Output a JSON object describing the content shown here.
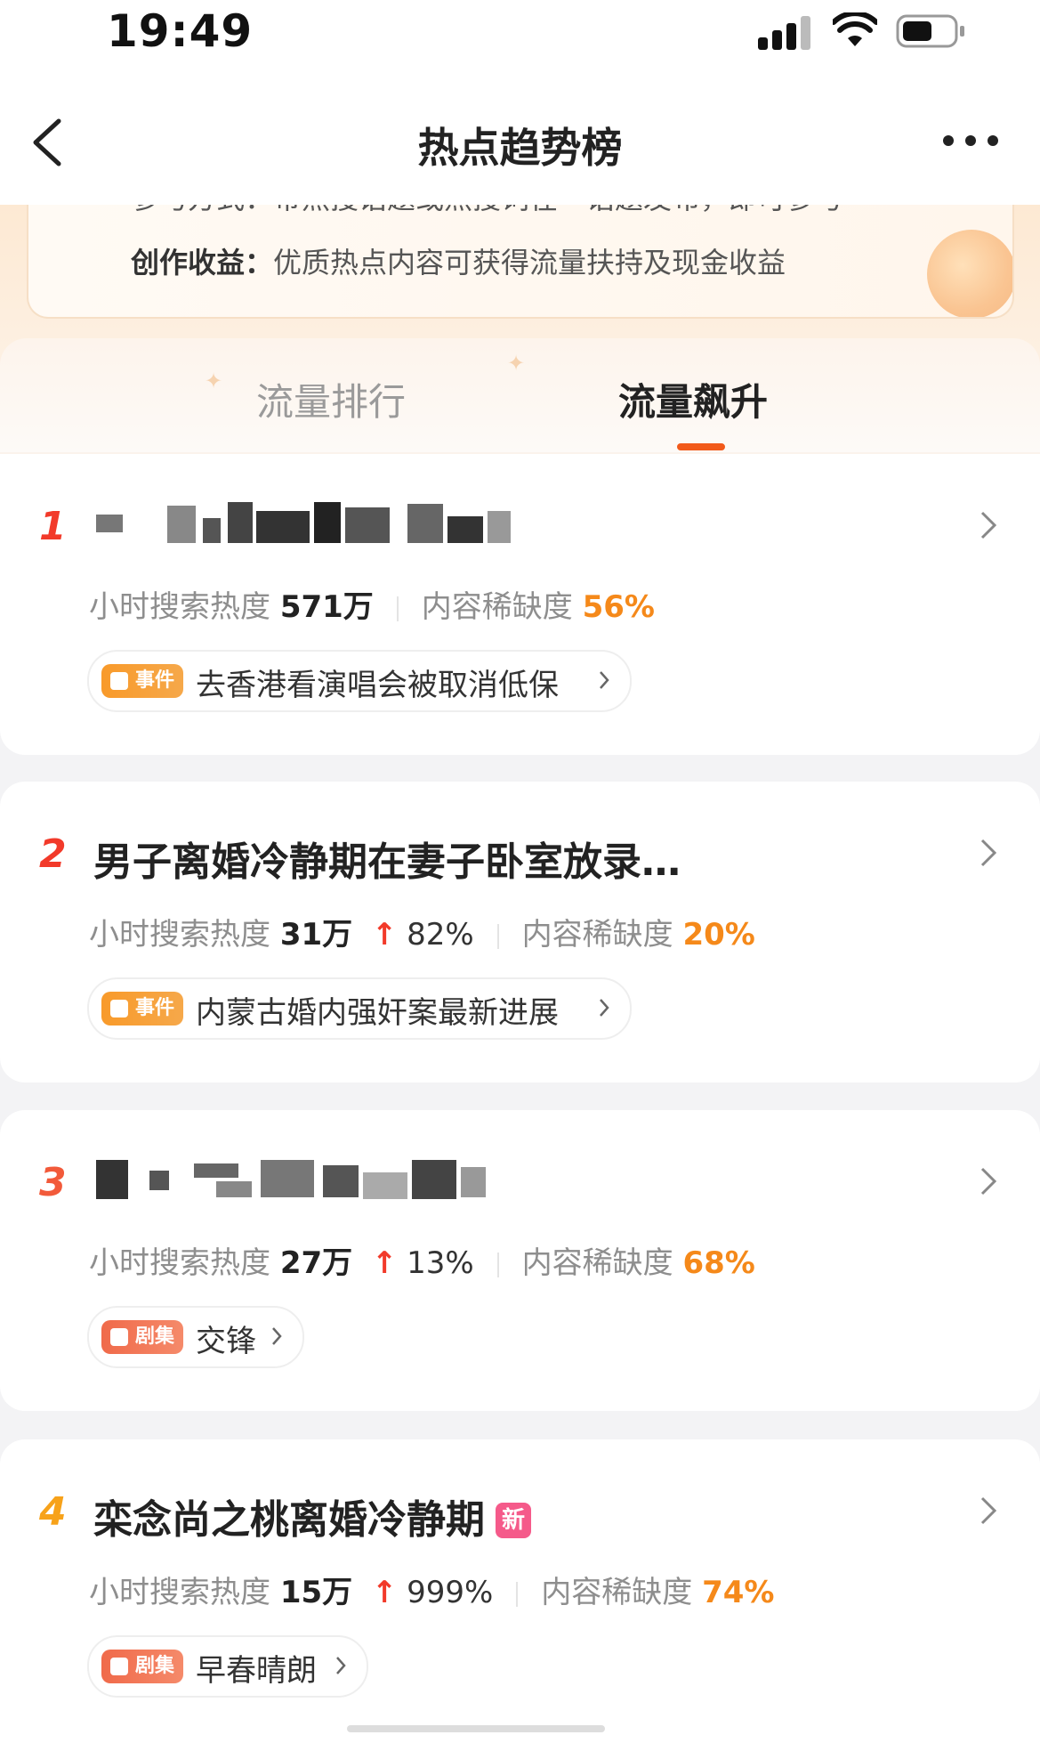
{
  "status_bar": {
    "time": "19:49"
  },
  "nav": {
    "title": "热点趋势榜"
  },
  "banner": {
    "cut_line": "参与方式：带热搜话题或热搜词在一话题发布，即可参与",
    "income_key": "创作收益：",
    "income_value": "优质热点内容可获得流量扶持及现金收益"
  },
  "tabs": [
    {
      "label": "流量排行",
      "active": false
    },
    {
      "label": "流量飙升",
      "active": true
    }
  ],
  "labels": {
    "hourly_search": "小时搜索热度",
    "scarcity": "内容稀缺度",
    "up_arrow": "↑"
  },
  "items": [
    {
      "rank": "1",
      "title": "",
      "title_blurred": true,
      "heat": "571万",
      "growth": "",
      "scarcity": "56%",
      "tag": "事件",
      "link": "去香港看演唱会被取消低保"
    },
    {
      "rank": "2",
      "title": "男子离婚冷静期在妻子卧室放录…",
      "title_blurred": false,
      "heat": "31万",
      "growth": "82%",
      "scarcity": "20%",
      "tag": "事件",
      "link": "内蒙古婚内强奸案最新进展"
    },
    {
      "rank": "3",
      "title": "",
      "title_blurred": true,
      "heat": "27万",
      "growth": "13%",
      "scarcity": "68%",
      "tag": "剧集",
      "link": "交锋"
    },
    {
      "rank": "4",
      "title": "栾念尚之桃离婚冷静期",
      "title_blurred": false,
      "badge": "新",
      "heat": "15万",
      "growth": "999%",
      "scarcity": "74%",
      "tag": "剧集",
      "link": "早春晴朗"
    }
  ],
  "colors": {
    "accent_orange": "#f25a1a",
    "rank_red": "#f23a2a",
    "rank_gold": "#f7a21a",
    "scarcity_orange": "#f5891a",
    "new_badge": "#f55a8a"
  },
  "icons": [
    "back-arrow-icon",
    "more-icon",
    "chevron-right-icon",
    "signal-icon",
    "wifi-icon",
    "battery-icon"
  ]
}
